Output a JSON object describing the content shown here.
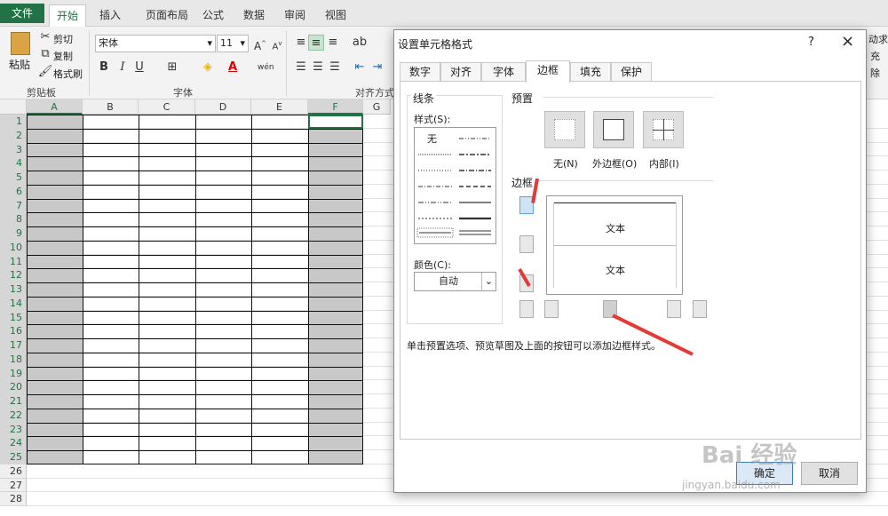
{
  "ribbon": {
    "tabs": [
      "文件",
      "开始",
      "插入",
      "页面布局",
      "公式",
      "数据",
      "审阅",
      "视图"
    ],
    "clipboard": {
      "paste": "粘贴",
      "cut": "剪切",
      "copy": "复制",
      "format_painter": "格式刷",
      "group": "剪贴板"
    },
    "font": {
      "name": "宋体",
      "size": "11",
      "group": "字体",
      "bold": "B",
      "italic": "I",
      "underline": "U"
    },
    "align": {
      "group": "对齐方式"
    },
    "right": {
      "autosum": "动求和",
      "fill": "充",
      "clear": "除"
    }
  },
  "sheet": {
    "columns": [
      "A",
      "B",
      "C",
      "D",
      "E",
      "F",
      "G"
    ],
    "rows": [
      "1",
      "2",
      "3",
      "4",
      "5",
      "6",
      "7",
      "8",
      "9",
      "10",
      "11",
      "12",
      "13",
      "14",
      "15",
      "16",
      "17",
      "18",
      "19",
      "20",
      "21",
      "22",
      "23",
      "24",
      "25",
      "26",
      "27",
      "28"
    ]
  },
  "dialog": {
    "title": "设置单元格格式",
    "help": "?",
    "close": "×",
    "tabs": [
      "数字",
      "对齐",
      "字体",
      "边框",
      "填充",
      "保护"
    ],
    "line": {
      "legend": "线条",
      "style_label": "样式(S):",
      "none": "无",
      "color_label": "颜色(C):",
      "color_value": "自动"
    },
    "presets": {
      "legend": "预置",
      "none": "无(N)",
      "outline": "外边框(O)",
      "inside": "内部(I)"
    },
    "border": {
      "legend": "边框",
      "text1": "文本",
      "text2": "文本"
    },
    "hint": "单击预置选项、预览草图及上面的按钮可以添加边框样式。",
    "ok": "确定",
    "cancel": "取消"
  },
  "watermark": {
    "brand": "Bai 经验",
    "url": "jingyan.baidu.com"
  }
}
